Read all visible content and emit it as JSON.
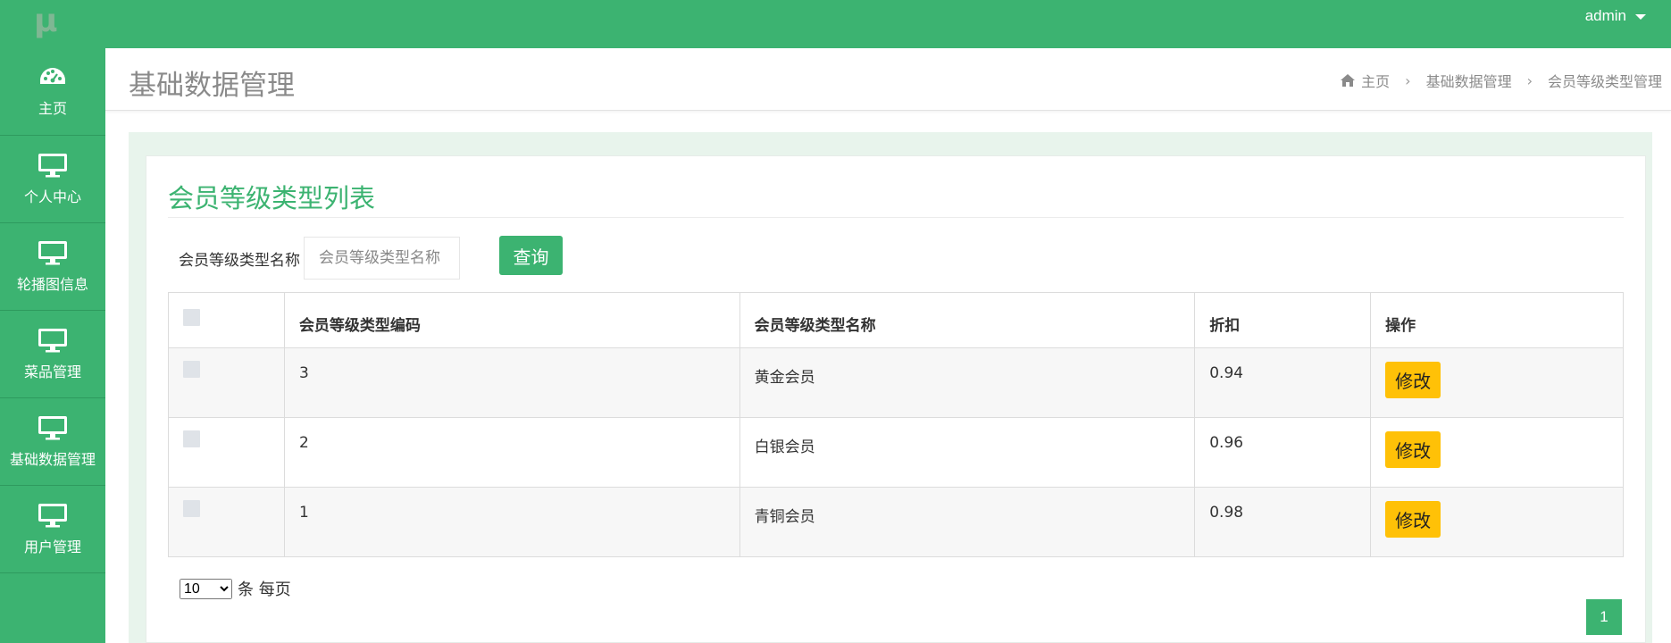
{
  "app": {
    "logo_text": "μ",
    "user": "admin"
  },
  "sidebar": {
    "items": [
      {
        "label": "主页",
        "icon": "dashboard-icon"
      },
      {
        "label": "个人中心",
        "icon": "monitor-icon"
      },
      {
        "label": "轮播图信息",
        "icon": "monitor-icon"
      },
      {
        "label": "菜品管理",
        "icon": "monitor-icon"
      },
      {
        "label": "基础数据管理",
        "icon": "monitor-icon"
      },
      {
        "label": "用户管理",
        "icon": "monitor-icon"
      }
    ]
  },
  "header": {
    "title": "基础数据管理",
    "breadcrumb": [
      "主页",
      "基础数据管理",
      "会员等级类型管理"
    ]
  },
  "panel": {
    "title": "会员等级类型列表",
    "search": {
      "label": "会员等级类型名称",
      "placeholder": "会员等级类型名称",
      "value": "",
      "button": "查询"
    },
    "table": {
      "columns": [
        "会员等级类型编码",
        "会员等级类型名称",
        "折扣",
        "操作"
      ],
      "rows": [
        {
          "code": "3",
          "name": "黄金会员",
          "discount": "0.94",
          "action": "修改"
        },
        {
          "code": "2",
          "name": "白银会员",
          "discount": "0.96",
          "action": "修改"
        },
        {
          "code": "1",
          "name": "青铜会员",
          "discount": "0.98",
          "action": "修改"
        }
      ]
    },
    "pagination": {
      "page_size": "10",
      "page_size_options": [
        "10"
      ],
      "per_page_label": "条 每页",
      "current_page": "1"
    }
  },
  "colors": {
    "primary": "#3cb371",
    "warning": "#ffc107",
    "content_bg": "#e8f4ec"
  }
}
